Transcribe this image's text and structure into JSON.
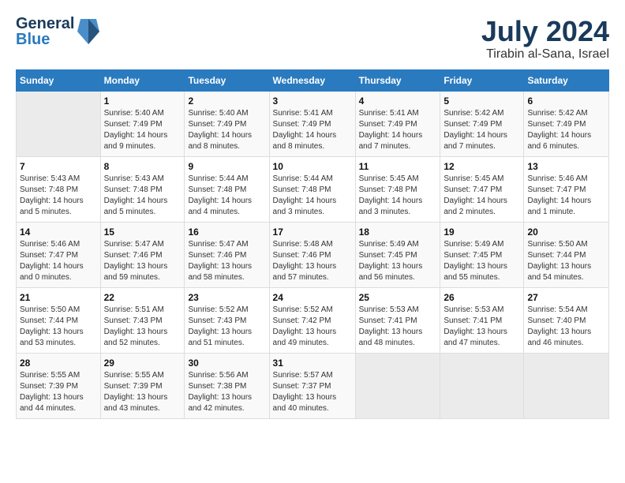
{
  "header": {
    "logo_general": "General",
    "logo_blue": "Blue",
    "month": "July 2024",
    "location": "Tirabin al-Sana, Israel"
  },
  "days_of_week": [
    "Sunday",
    "Monday",
    "Tuesday",
    "Wednesday",
    "Thursday",
    "Friday",
    "Saturday"
  ],
  "weeks": [
    [
      {
        "day": "",
        "sunrise": "",
        "sunset": "",
        "daylight": ""
      },
      {
        "day": "1",
        "sunrise": "Sunrise: 5:40 AM",
        "sunset": "Sunset: 7:49 PM",
        "daylight": "Daylight: 14 hours and 9 minutes."
      },
      {
        "day": "2",
        "sunrise": "Sunrise: 5:40 AM",
        "sunset": "Sunset: 7:49 PM",
        "daylight": "Daylight: 14 hours and 8 minutes."
      },
      {
        "day": "3",
        "sunrise": "Sunrise: 5:41 AM",
        "sunset": "Sunset: 7:49 PM",
        "daylight": "Daylight: 14 hours and 8 minutes."
      },
      {
        "day": "4",
        "sunrise": "Sunrise: 5:41 AM",
        "sunset": "Sunset: 7:49 PM",
        "daylight": "Daylight: 14 hours and 7 minutes."
      },
      {
        "day": "5",
        "sunrise": "Sunrise: 5:42 AM",
        "sunset": "Sunset: 7:49 PM",
        "daylight": "Daylight: 14 hours and 7 minutes."
      },
      {
        "day": "6",
        "sunrise": "Sunrise: 5:42 AM",
        "sunset": "Sunset: 7:49 PM",
        "daylight": "Daylight: 14 hours and 6 minutes."
      }
    ],
    [
      {
        "day": "7",
        "sunrise": "Sunrise: 5:43 AM",
        "sunset": "Sunset: 7:48 PM",
        "daylight": "Daylight: 14 hours and 5 minutes."
      },
      {
        "day": "8",
        "sunrise": "Sunrise: 5:43 AM",
        "sunset": "Sunset: 7:48 PM",
        "daylight": "Daylight: 14 hours and 5 minutes."
      },
      {
        "day": "9",
        "sunrise": "Sunrise: 5:44 AM",
        "sunset": "Sunset: 7:48 PM",
        "daylight": "Daylight: 14 hours and 4 minutes."
      },
      {
        "day": "10",
        "sunrise": "Sunrise: 5:44 AM",
        "sunset": "Sunset: 7:48 PM",
        "daylight": "Daylight: 14 hours and 3 minutes."
      },
      {
        "day": "11",
        "sunrise": "Sunrise: 5:45 AM",
        "sunset": "Sunset: 7:48 PM",
        "daylight": "Daylight: 14 hours and 3 minutes."
      },
      {
        "day": "12",
        "sunrise": "Sunrise: 5:45 AM",
        "sunset": "Sunset: 7:47 PM",
        "daylight": "Daylight: 14 hours and 2 minutes."
      },
      {
        "day": "13",
        "sunrise": "Sunrise: 5:46 AM",
        "sunset": "Sunset: 7:47 PM",
        "daylight": "Daylight: 14 hours and 1 minute."
      }
    ],
    [
      {
        "day": "14",
        "sunrise": "Sunrise: 5:46 AM",
        "sunset": "Sunset: 7:47 PM",
        "daylight": "Daylight: 14 hours and 0 minutes."
      },
      {
        "day": "15",
        "sunrise": "Sunrise: 5:47 AM",
        "sunset": "Sunset: 7:46 PM",
        "daylight": "Daylight: 13 hours and 59 minutes."
      },
      {
        "day": "16",
        "sunrise": "Sunrise: 5:47 AM",
        "sunset": "Sunset: 7:46 PM",
        "daylight": "Daylight: 13 hours and 58 minutes."
      },
      {
        "day": "17",
        "sunrise": "Sunrise: 5:48 AM",
        "sunset": "Sunset: 7:46 PM",
        "daylight": "Daylight: 13 hours and 57 minutes."
      },
      {
        "day": "18",
        "sunrise": "Sunrise: 5:49 AM",
        "sunset": "Sunset: 7:45 PM",
        "daylight": "Daylight: 13 hours and 56 minutes."
      },
      {
        "day": "19",
        "sunrise": "Sunrise: 5:49 AM",
        "sunset": "Sunset: 7:45 PM",
        "daylight": "Daylight: 13 hours and 55 minutes."
      },
      {
        "day": "20",
        "sunrise": "Sunrise: 5:50 AM",
        "sunset": "Sunset: 7:44 PM",
        "daylight": "Daylight: 13 hours and 54 minutes."
      }
    ],
    [
      {
        "day": "21",
        "sunrise": "Sunrise: 5:50 AM",
        "sunset": "Sunset: 7:44 PM",
        "daylight": "Daylight: 13 hours and 53 minutes."
      },
      {
        "day": "22",
        "sunrise": "Sunrise: 5:51 AM",
        "sunset": "Sunset: 7:43 PM",
        "daylight": "Daylight: 13 hours and 52 minutes."
      },
      {
        "day": "23",
        "sunrise": "Sunrise: 5:52 AM",
        "sunset": "Sunset: 7:43 PM",
        "daylight": "Daylight: 13 hours and 51 minutes."
      },
      {
        "day": "24",
        "sunrise": "Sunrise: 5:52 AM",
        "sunset": "Sunset: 7:42 PM",
        "daylight": "Daylight: 13 hours and 49 minutes."
      },
      {
        "day": "25",
        "sunrise": "Sunrise: 5:53 AM",
        "sunset": "Sunset: 7:41 PM",
        "daylight": "Daylight: 13 hours and 48 minutes."
      },
      {
        "day": "26",
        "sunrise": "Sunrise: 5:53 AM",
        "sunset": "Sunset: 7:41 PM",
        "daylight": "Daylight: 13 hours and 47 minutes."
      },
      {
        "day": "27",
        "sunrise": "Sunrise: 5:54 AM",
        "sunset": "Sunset: 7:40 PM",
        "daylight": "Daylight: 13 hours and 46 minutes."
      }
    ],
    [
      {
        "day": "28",
        "sunrise": "Sunrise: 5:55 AM",
        "sunset": "Sunset: 7:39 PM",
        "daylight": "Daylight: 13 hours and 44 minutes."
      },
      {
        "day": "29",
        "sunrise": "Sunrise: 5:55 AM",
        "sunset": "Sunset: 7:39 PM",
        "daylight": "Daylight: 13 hours and 43 minutes."
      },
      {
        "day": "30",
        "sunrise": "Sunrise: 5:56 AM",
        "sunset": "Sunset: 7:38 PM",
        "daylight": "Daylight: 13 hours and 42 minutes."
      },
      {
        "day": "31",
        "sunrise": "Sunrise: 5:57 AM",
        "sunset": "Sunset: 7:37 PM",
        "daylight": "Daylight: 13 hours and 40 minutes."
      },
      {
        "day": "",
        "sunrise": "",
        "sunset": "",
        "daylight": ""
      },
      {
        "day": "",
        "sunrise": "",
        "sunset": "",
        "daylight": ""
      },
      {
        "day": "",
        "sunrise": "",
        "sunset": "",
        "daylight": ""
      }
    ]
  ]
}
